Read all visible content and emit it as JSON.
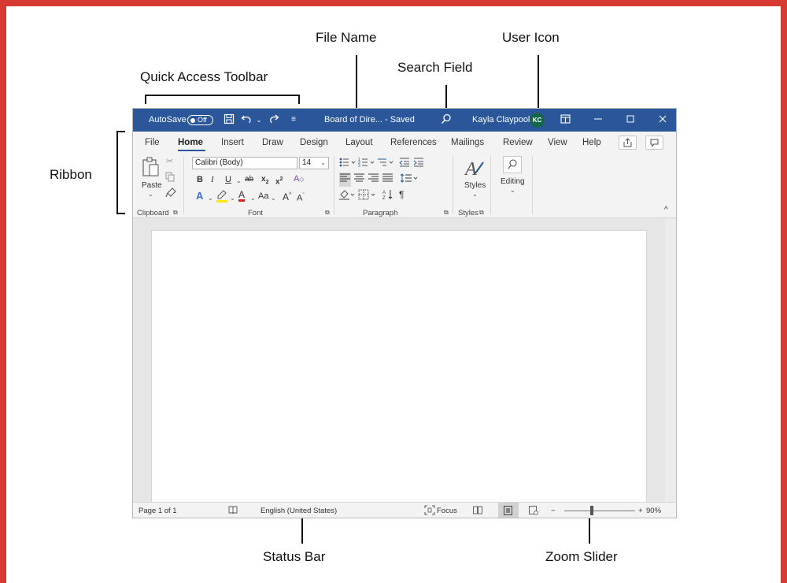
{
  "callouts": {
    "file_name": "File Name",
    "user_icon": "User Icon",
    "search_field": "Search Field",
    "quick_access_toolbar": "Quick Access Toolbar",
    "ribbon": "Ribbon",
    "status_bar": "Status Bar",
    "zoom_slider": "Zoom Slider"
  },
  "titlebar": {
    "autosave_label": "AutoSave",
    "autosave_state": "Off",
    "document_name": "Board of Dire...",
    "save_status": "- Saved",
    "user_name": "Kayla Claypool",
    "user_initials": "KC"
  },
  "tabs": [
    "File",
    "Home",
    "Insert",
    "Draw",
    "Design",
    "Layout",
    "References",
    "Mailings",
    "Review",
    "View",
    "Help"
  ],
  "ribbon": {
    "paste_label": "Paste",
    "font_name": "Calibri (Body)",
    "font_size": "14",
    "styles_label": "Styles",
    "editing_label": "Editing",
    "groups": {
      "clipboard": "Clipboard",
      "font": "Font",
      "paragraph": "Paragraph",
      "styles": "Styles"
    }
  },
  "statusbar": {
    "page_info": "Page 1 of 1",
    "language": "English (United States)",
    "focus_label": "Focus",
    "zoom_minus": "−",
    "zoom_plus": "+",
    "zoom_level": "90%"
  },
  "colors": {
    "titlebar": "#2b579a",
    "avatar": "#15664d",
    "frame_border": "#d63a32"
  }
}
